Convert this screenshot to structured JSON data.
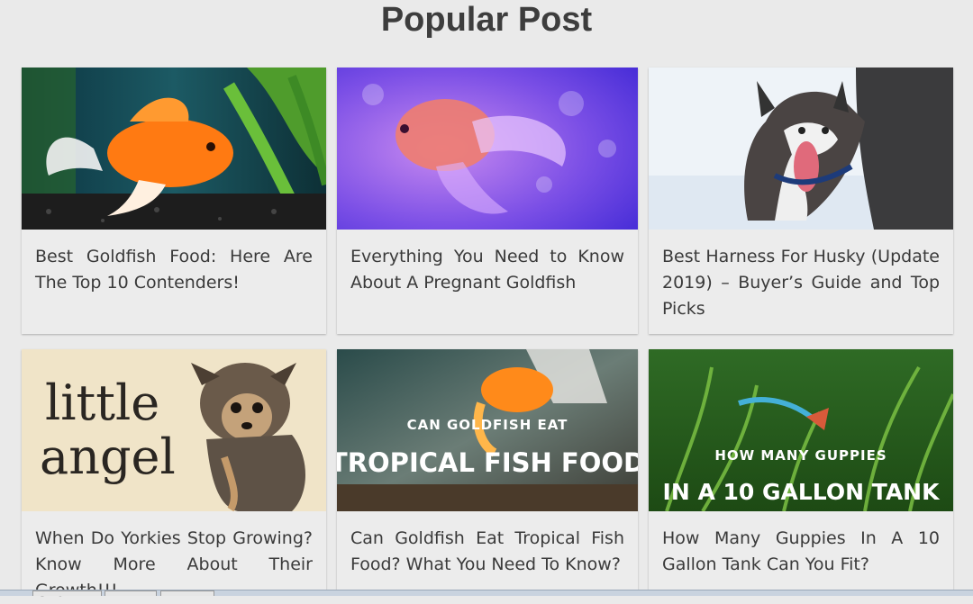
{
  "section": {
    "title": "Popular Post"
  },
  "posts": [
    {
      "title": "Best Goldfish Food: Here Are The Top 10 Contenders!",
      "image": "goldfish-aquarium-image"
    },
    {
      "title": "Everything You Need to Know About A Pregnant Goldfish",
      "image": "purple-goldfish-image"
    },
    {
      "title": "Best Harness For Husky (Update 2019) – Buyer’s Guide and Top Picks",
      "image": "husky-snow-image"
    },
    {
      "title": "When Do Yorkies Stop Growing? Know More About Their Growth!!!",
      "image": "little-angel-yorkie-image",
      "image_text": [
        "little",
        "angel"
      ]
    },
    {
      "title": "Can Goldfish Eat Tropical Fish Food? What You Need To Know?",
      "image": "goldfish-tropical-food-image",
      "image_text": [
        "CAN GOLDFISH EAT",
        "TROPICAL FISH FOOD"
      ]
    },
    {
      "title": "How Many Guppies In A 10 Gallon Tank Can You Fit?",
      "image": "guppies-tank-image",
      "image_text": [
        "HOW MANY GUPPIES",
        "IN A 10 GALLON TANK"
      ]
    }
  ]
}
